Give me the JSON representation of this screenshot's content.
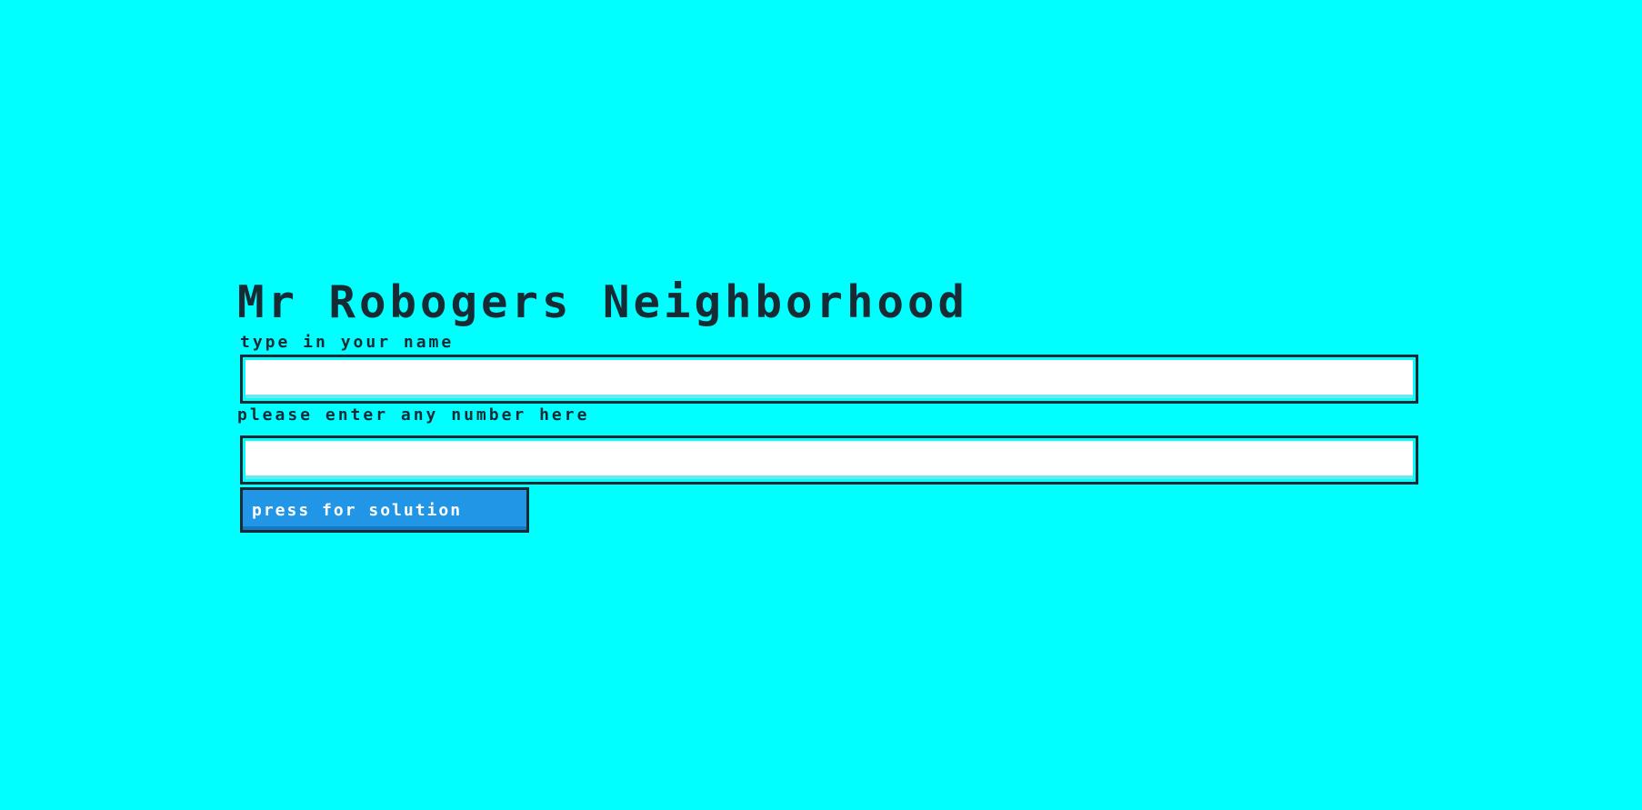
{
  "page": {
    "title": "Mr Robogers Neighborhood"
  },
  "form": {
    "name_label": "type in your name",
    "name_value": "",
    "number_label": "please enter any number here",
    "number_value": "",
    "submit_label": "press for solution"
  },
  "colors": {
    "background": "#00ffff",
    "text": "#172b35",
    "button": "#2196e6",
    "button_text": "#ffffff",
    "input_background": "#ffffff"
  }
}
